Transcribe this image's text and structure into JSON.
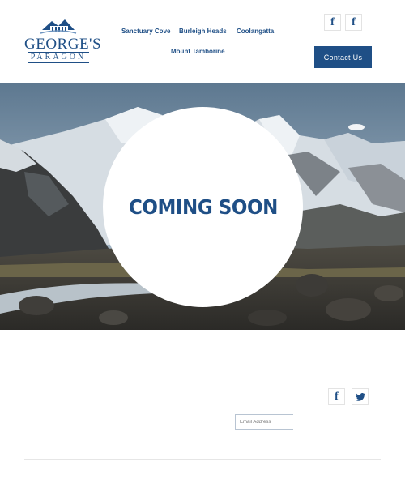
{
  "brand": {
    "name_line1": "GEORGE'S",
    "name_line2": "PARAGON"
  },
  "nav": {
    "items": [
      {
        "label": "Sanctuary Cove"
      },
      {
        "label": "Burleigh Heads"
      },
      {
        "label": "Coolangatta"
      },
      {
        "label": "Mount Tamborine"
      }
    ]
  },
  "header_social": {
    "facebook_1": "f",
    "facebook_2": "f"
  },
  "contact": {
    "label": "Contact Us"
  },
  "hero": {
    "headline": "COMING SOON"
  },
  "footer": {
    "social": {
      "facebook": "f",
      "twitter": "twitter-icon"
    },
    "email": {
      "placeholder": "Email Address"
    }
  },
  "colors": {
    "brand_blue": "#1f4f86",
    "background": "#ffffff"
  }
}
